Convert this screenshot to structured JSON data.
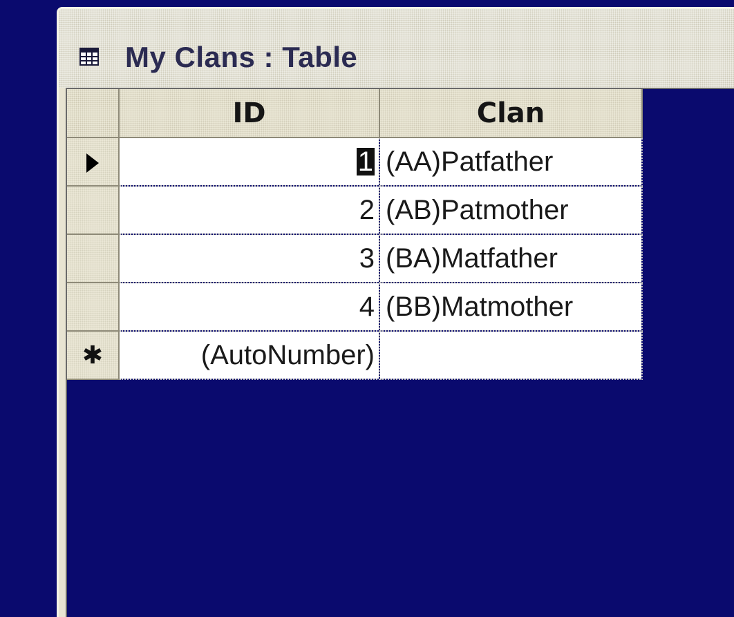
{
  "window": {
    "title": "My Clans : Table",
    "title_icon": "table-icon"
  },
  "datasheet": {
    "columns": [
      "ID",
      "Clan"
    ],
    "rows": [
      {
        "id": "1",
        "clan": "(AA)Patfather",
        "current": true
      },
      {
        "id": "2",
        "clan": "(AB)Patmother",
        "current": false
      },
      {
        "id": "3",
        "clan": "(BA)Matfather",
        "current": false
      },
      {
        "id": "4",
        "clan": "(BB)Matmother",
        "current": false
      }
    ],
    "new_row": {
      "marker": "✱",
      "id_placeholder": "(AutoNumber)",
      "clan": ""
    },
    "current_row_marker": "current-record-arrow-icon"
  },
  "colors": {
    "background": "#0a0a6e",
    "header_bg": "#ece9d8",
    "cell_bg": "#ffffff"
  }
}
